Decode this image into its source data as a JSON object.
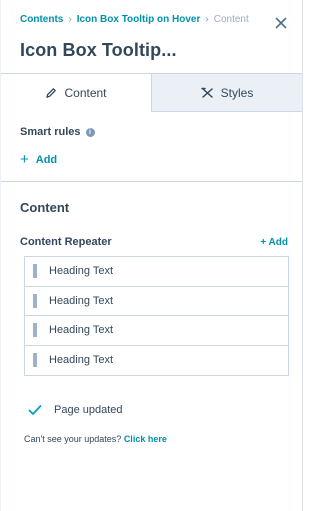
{
  "breadcrumb": {
    "items": [
      "Contents",
      "Icon Box Tooltip on Hover",
      "Content"
    ]
  },
  "header": {
    "title": "Icon Box Tooltip..."
  },
  "tabs": [
    {
      "label": "Content",
      "icon": "pencil-icon",
      "active": true
    },
    {
      "label": "Styles",
      "icon": "styles-icon",
      "active": false
    }
  ],
  "smart_rules": {
    "label": "Smart rules",
    "info_icon": "i",
    "add_label": "Add"
  },
  "content_section": {
    "title": "Content",
    "repeater": {
      "label": "Content Repeater",
      "add_label": "+ Add",
      "items": [
        "Heading Text",
        "Heading Text",
        "Heading Text",
        "Heading Text"
      ]
    }
  },
  "status": {
    "message": "Page updated",
    "help_text": "Can't see your updates?",
    "help_link": "Click here"
  },
  "colors": {
    "link": "#0091ae",
    "text": "#33475b",
    "border": "#cbd6e2",
    "inactive_tab_bg": "#eaf0f6",
    "check": "#00a4bd"
  }
}
